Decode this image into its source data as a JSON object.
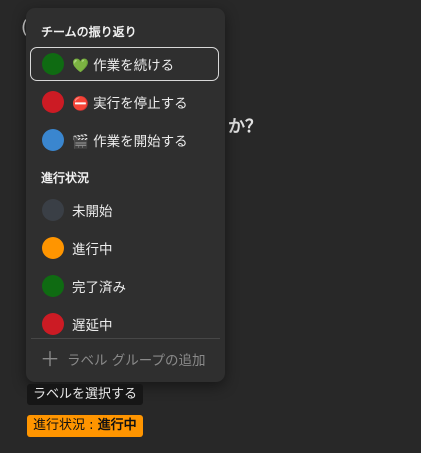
{
  "background": {
    "paren": "(",
    "question": "か？"
  },
  "menu": {
    "section_retro": {
      "title": "チームの振り返り",
      "items": [
        {
          "label": "💚 作業を続ける",
          "color": "#0f6b12",
          "selected": true
        },
        {
          "label": "⛔ 実行を停止する",
          "color": "#cc1b24",
          "selected": false
        },
        {
          "label": "🎬 作業を開始する",
          "color": "#3a86cf",
          "selected": false
        }
      ]
    },
    "section_progress": {
      "title": "進行状況",
      "items": [
        {
          "label": "未開始",
          "color": "#3a3f46"
        },
        {
          "label": "進行中",
          "color": "#ff9500"
        },
        {
          "label": "完了済み",
          "color": "#0f6b12"
        },
        {
          "label": "遅延中",
          "color": "#cc1b24"
        }
      ]
    },
    "add_group_label": "ラベル グループの追加",
    "add_icon": "plus-icon"
  },
  "chips": {
    "select_label": "ラベルを選択する",
    "status_prefix": "進行状況 : ",
    "status_value": "進行中",
    "status_color": "#ff9500"
  }
}
